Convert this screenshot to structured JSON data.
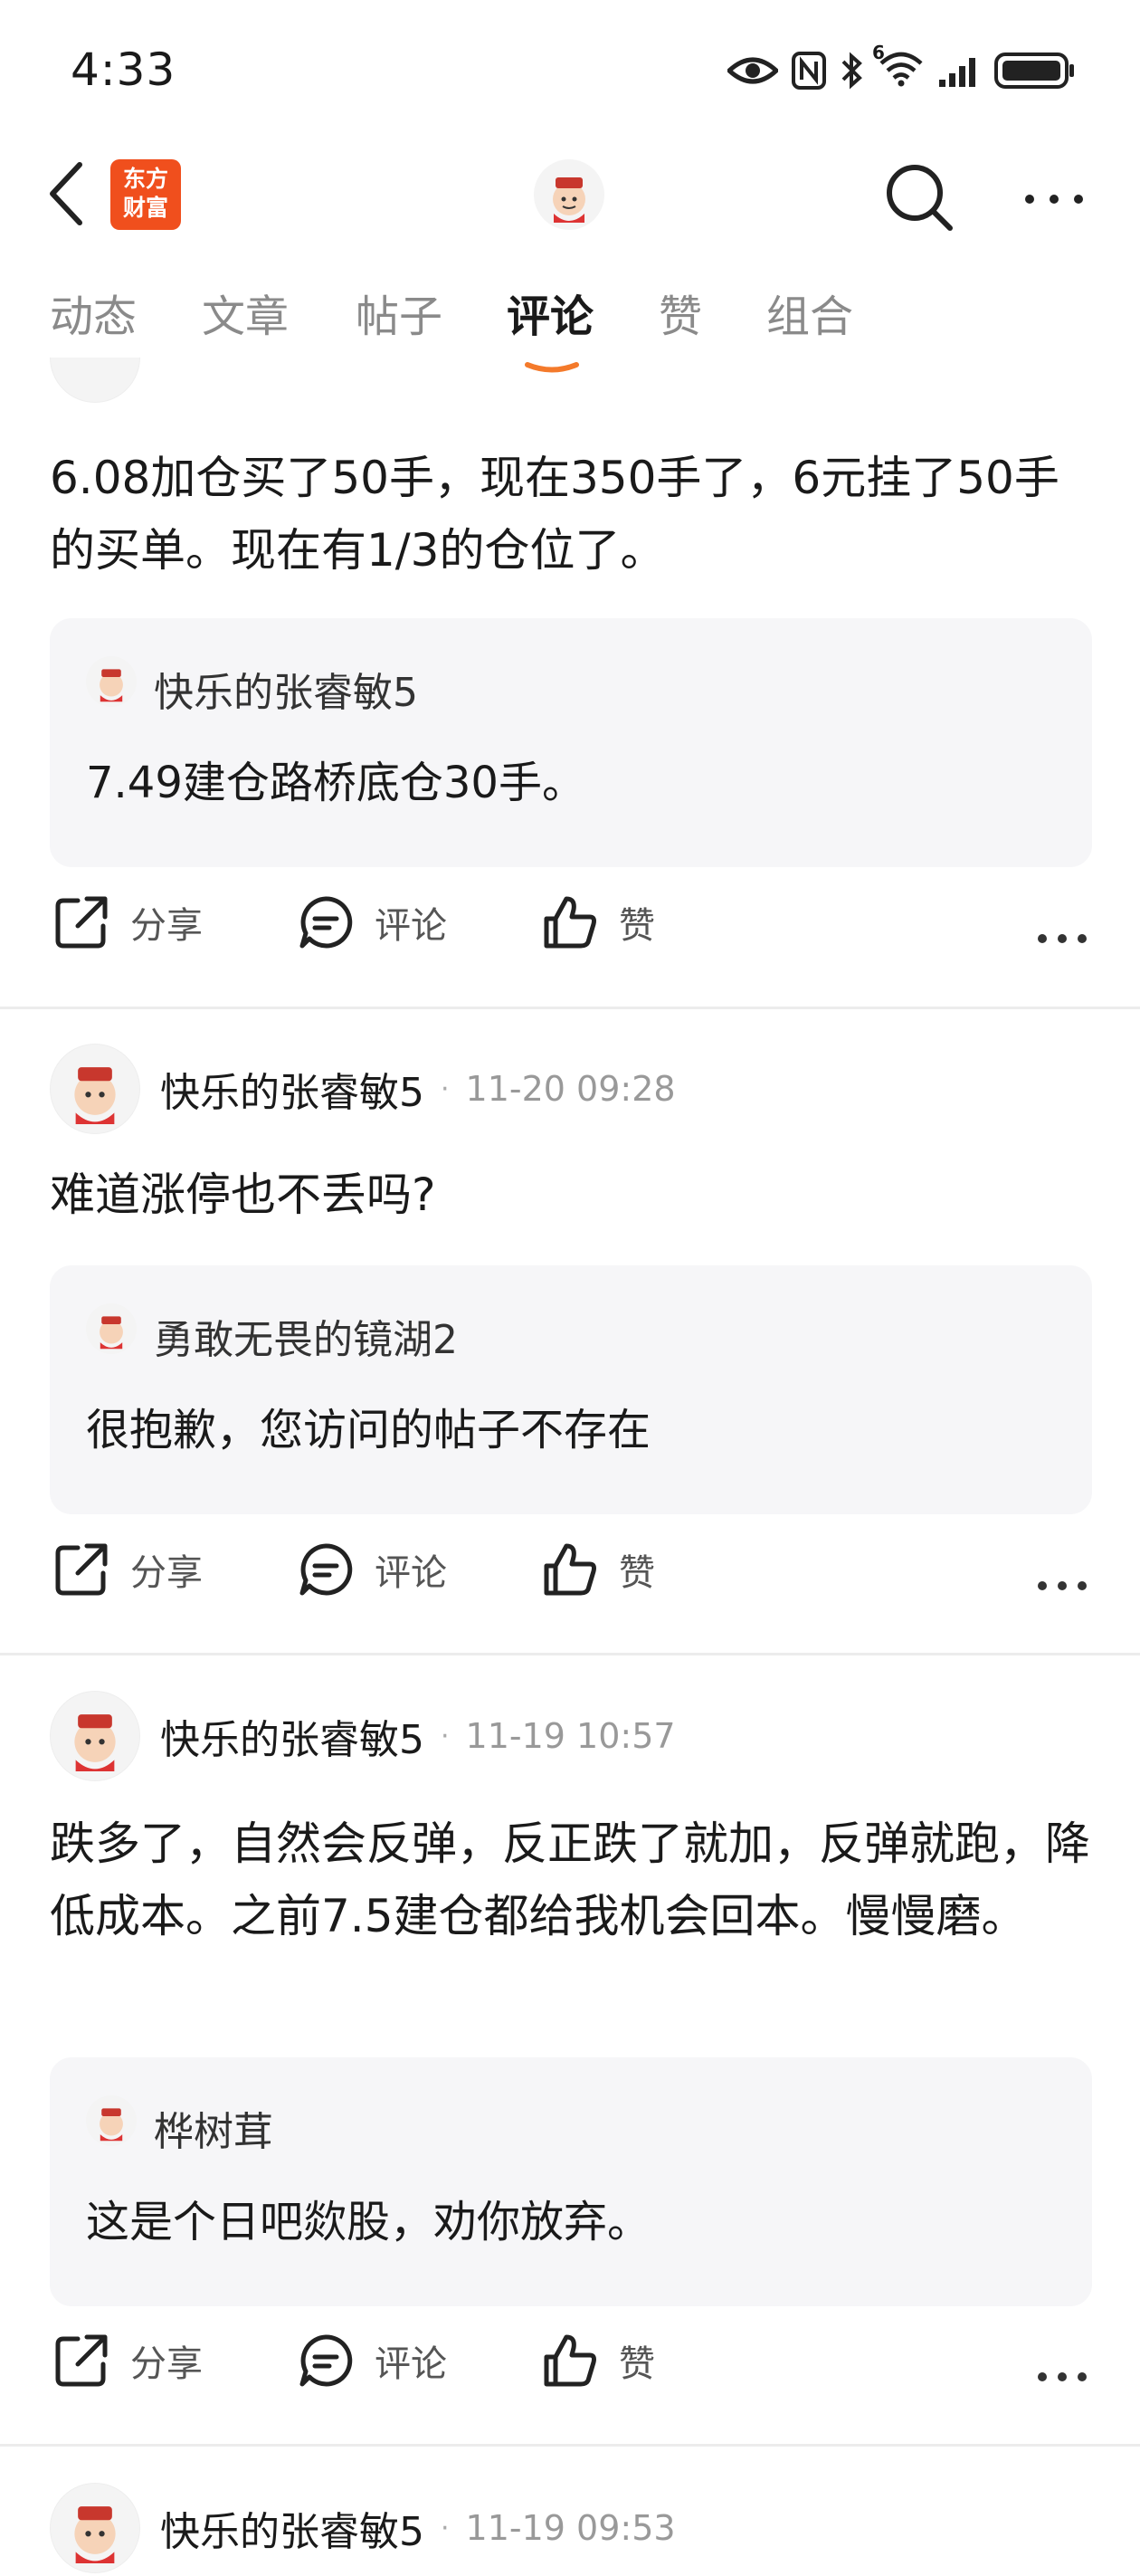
{
  "status": {
    "time": "4:33",
    "network": "6"
  },
  "nav": {
    "logo_line1": "东方",
    "logo_line2": "财富"
  },
  "tabs": [
    {
      "label": "动态"
    },
    {
      "label": "文章"
    },
    {
      "label": "帖子"
    },
    {
      "label": "评论"
    },
    {
      "label": "赞"
    },
    {
      "label": "组合"
    }
  ],
  "active_tab": "评论",
  "posts": [
    {
      "text": "6.08加仓买了50手，现在350手了，6元挂了50手的买单。现在有1/3的仓位了。",
      "quote_author": "快乐的张睿敏5",
      "quote_text": "7.49建仓路桥底仓30手。"
    },
    {
      "author": "快乐的张睿敏5",
      "time": "11-20 09:28",
      "text": "难道涨停也不丢吗?",
      "quote_author": "勇敢无畏的镜湖2",
      "quote_text": "很抱歉，您访问的帖子不存在"
    },
    {
      "author": "快乐的张睿敏5",
      "time": "11-19 10:57",
      "text": "跌多了，自然会反弹，反正跌了就加，反弹就跑，降低成本。之前7.5建仓都给我机会回本。慢慢磨。",
      "quote_author": "桦树茸",
      "quote_text": "这是个日吧欻股，劝你放弃。"
    },
    {
      "author": "快乐的张睿敏5",
      "time": "11-19 09:53"
    }
  ],
  "actions": {
    "share": "分享",
    "comment": "评论",
    "like": "赞"
  },
  "colors": {
    "accent": "#f04f1d",
    "tab_underline": "#f47a2b"
  },
  "icons": [
    "eye-icon",
    "nfc-icon",
    "bluetooth-icon",
    "wifi-icon",
    "signal-icon",
    "battery-icon",
    "back-icon",
    "search-icon",
    "more-icon",
    "share-icon",
    "comment-icon",
    "like-icon"
  ]
}
